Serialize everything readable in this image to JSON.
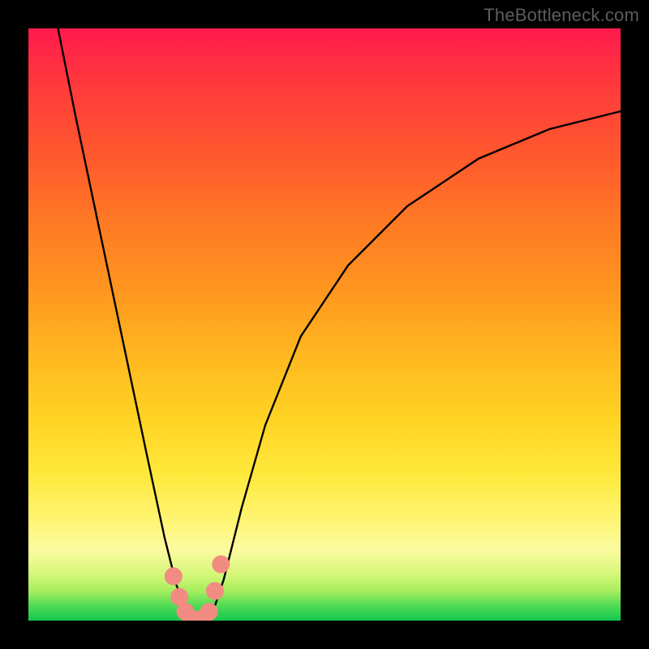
{
  "watermark": "TheBottleneck.com",
  "chart_data": {
    "type": "line",
    "title": "",
    "xlabel": "",
    "ylabel": "",
    "xlim": [
      0,
      100
    ],
    "ylim": [
      0,
      100
    ],
    "grid": false,
    "legend": false,
    "background_gradient_stops": [
      {
        "pos": 0,
        "color": "#ff1a4d"
      },
      {
        "pos": 50,
        "color": "#ffb71f"
      },
      {
        "pos": 85,
        "color": "#fff36a"
      },
      {
        "pos": 100,
        "color": "#13c94e"
      }
    ],
    "series": [
      {
        "name": "bottleneck-curve",
        "color": "#000000",
        "x": [
          5,
          8,
          12,
          16,
          20,
          23,
          25,
          27,
          29,
          31,
          33,
          36,
          40,
          46,
          54,
          64,
          76,
          88,
          100
        ],
        "y": [
          100,
          85,
          66,
          47,
          28,
          14,
          6,
          1,
          0,
          1,
          7,
          19,
          33,
          48,
          60,
          70,
          78,
          83,
          86
        ]
      },
      {
        "name": "highlight-dots",
        "color": "#f28b82",
        "type": "scatter",
        "x": [
          24.5,
          25.5,
          26.5,
          27.5,
          28.5,
          29.5,
          30.5,
          31.5,
          32.5
        ],
        "y": [
          7.5,
          4,
          1.5,
          0.3,
          0.2,
          0.3,
          1.5,
          5.0,
          9.5
        ]
      }
    ],
    "minimum": {
      "x": 29,
      "y": 0
    }
  }
}
